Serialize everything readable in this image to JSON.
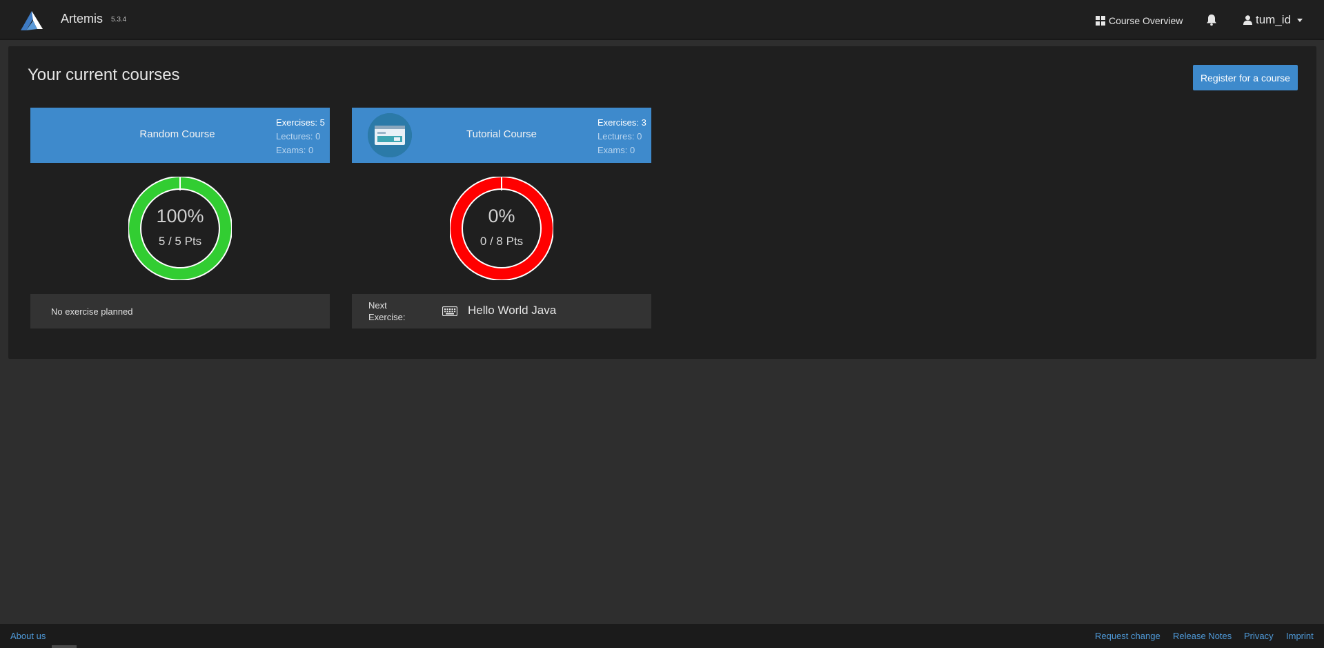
{
  "app": {
    "name": "Artemis",
    "version": "5.3.4"
  },
  "nav": {
    "course_overview": "Course Overview",
    "user": "tum_id"
  },
  "page": {
    "title": "Your current courses",
    "register_button": "Register for a course"
  },
  "colors": {
    "accent": "#3e8acc",
    "success": "#32cd32",
    "danger": "#ff0000"
  },
  "courses": [
    {
      "title": "Random Course",
      "stats": {
        "exercises": "Exercises: 5",
        "lectures": "Lectures: 0",
        "exams": "Exams: 0"
      },
      "has_icon": false,
      "progress": 1.0,
      "percent_label": "100%",
      "points_label": "5 / 5 Pts",
      "ring_color": "#32cd32",
      "footer_text": "No exercise planned"
    },
    {
      "title": "Tutorial Course",
      "stats": {
        "exercises": "Exercises: 3",
        "lectures": "Lectures: 0",
        "exams": "Exams: 0"
      },
      "has_icon": true,
      "progress": 0.0,
      "percent_label": "0%",
      "points_label": "0 / 8 Pts",
      "ring_color": "#ff0000",
      "next_label": "Next Exercise:",
      "next_exercise": "Hello World Java",
      "next_exercise_icon": "keyboard-icon"
    }
  ],
  "footer": {
    "about": "About us",
    "request_change": "Request change",
    "release_notes": "Release Notes",
    "privacy": "Privacy",
    "imprint": "Imprint"
  }
}
